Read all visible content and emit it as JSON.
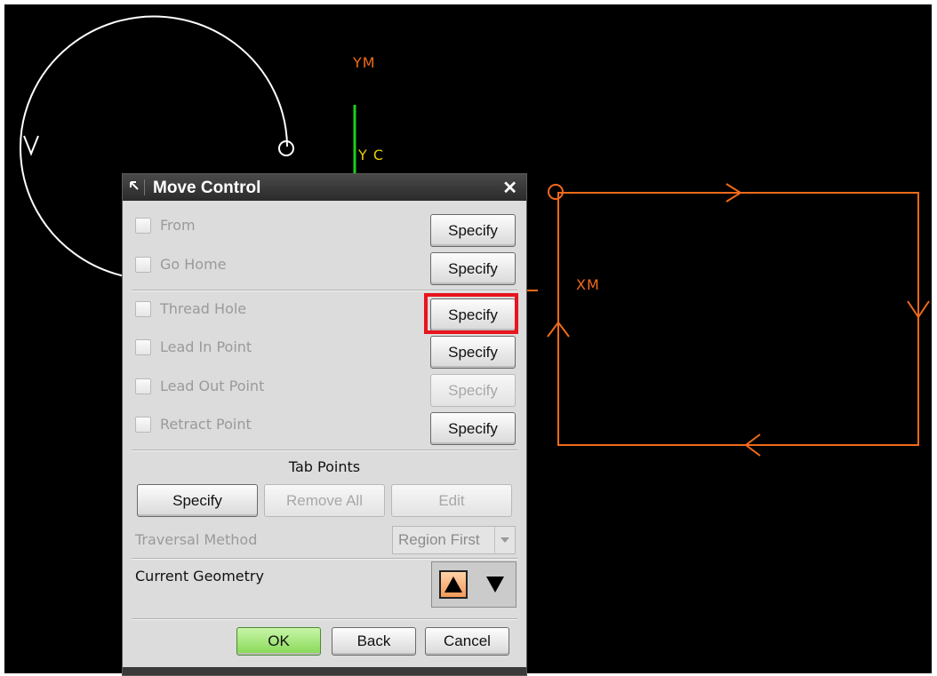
{
  "viewport": {
    "labels": {
      "ym": "YM",
      "yc": "Y C",
      "xm": "XM"
    },
    "colors": {
      "background": "#000000",
      "path": "#f06a1a",
      "geometry": "#ffffff",
      "axis_y": "#1ccf1c"
    }
  },
  "dialog": {
    "title": "Move Control",
    "icons": {
      "pin": "pin-icon",
      "close": "close-icon"
    },
    "rows": [
      {
        "label": "From",
        "button": "Specify"
      },
      {
        "label": "Go Home",
        "button": "Specify"
      },
      {
        "label": "Thread Hole",
        "button": "Specify"
      },
      {
        "label": "Lead In Point",
        "button": "Specify"
      },
      {
        "label": "Lead Out Point",
        "button": "Specify"
      },
      {
        "label": "Retract Point",
        "button": "Specify"
      }
    ],
    "tab_points": {
      "title": "Tab Points",
      "specify": "Specify",
      "remove_all": "Remove All",
      "edit": "Edit"
    },
    "traversal": {
      "label": "Traversal Method",
      "value": "Region First"
    },
    "current_geometry": {
      "label": "Current Geometry",
      "up_icon": "triangle-up-icon",
      "down_icon": "triangle-down-icon"
    },
    "footer": {
      "ok": "OK",
      "back": "Back",
      "cancel": "Cancel"
    },
    "highlight_color": "#e8141e",
    "ok_color": "#86d855"
  }
}
